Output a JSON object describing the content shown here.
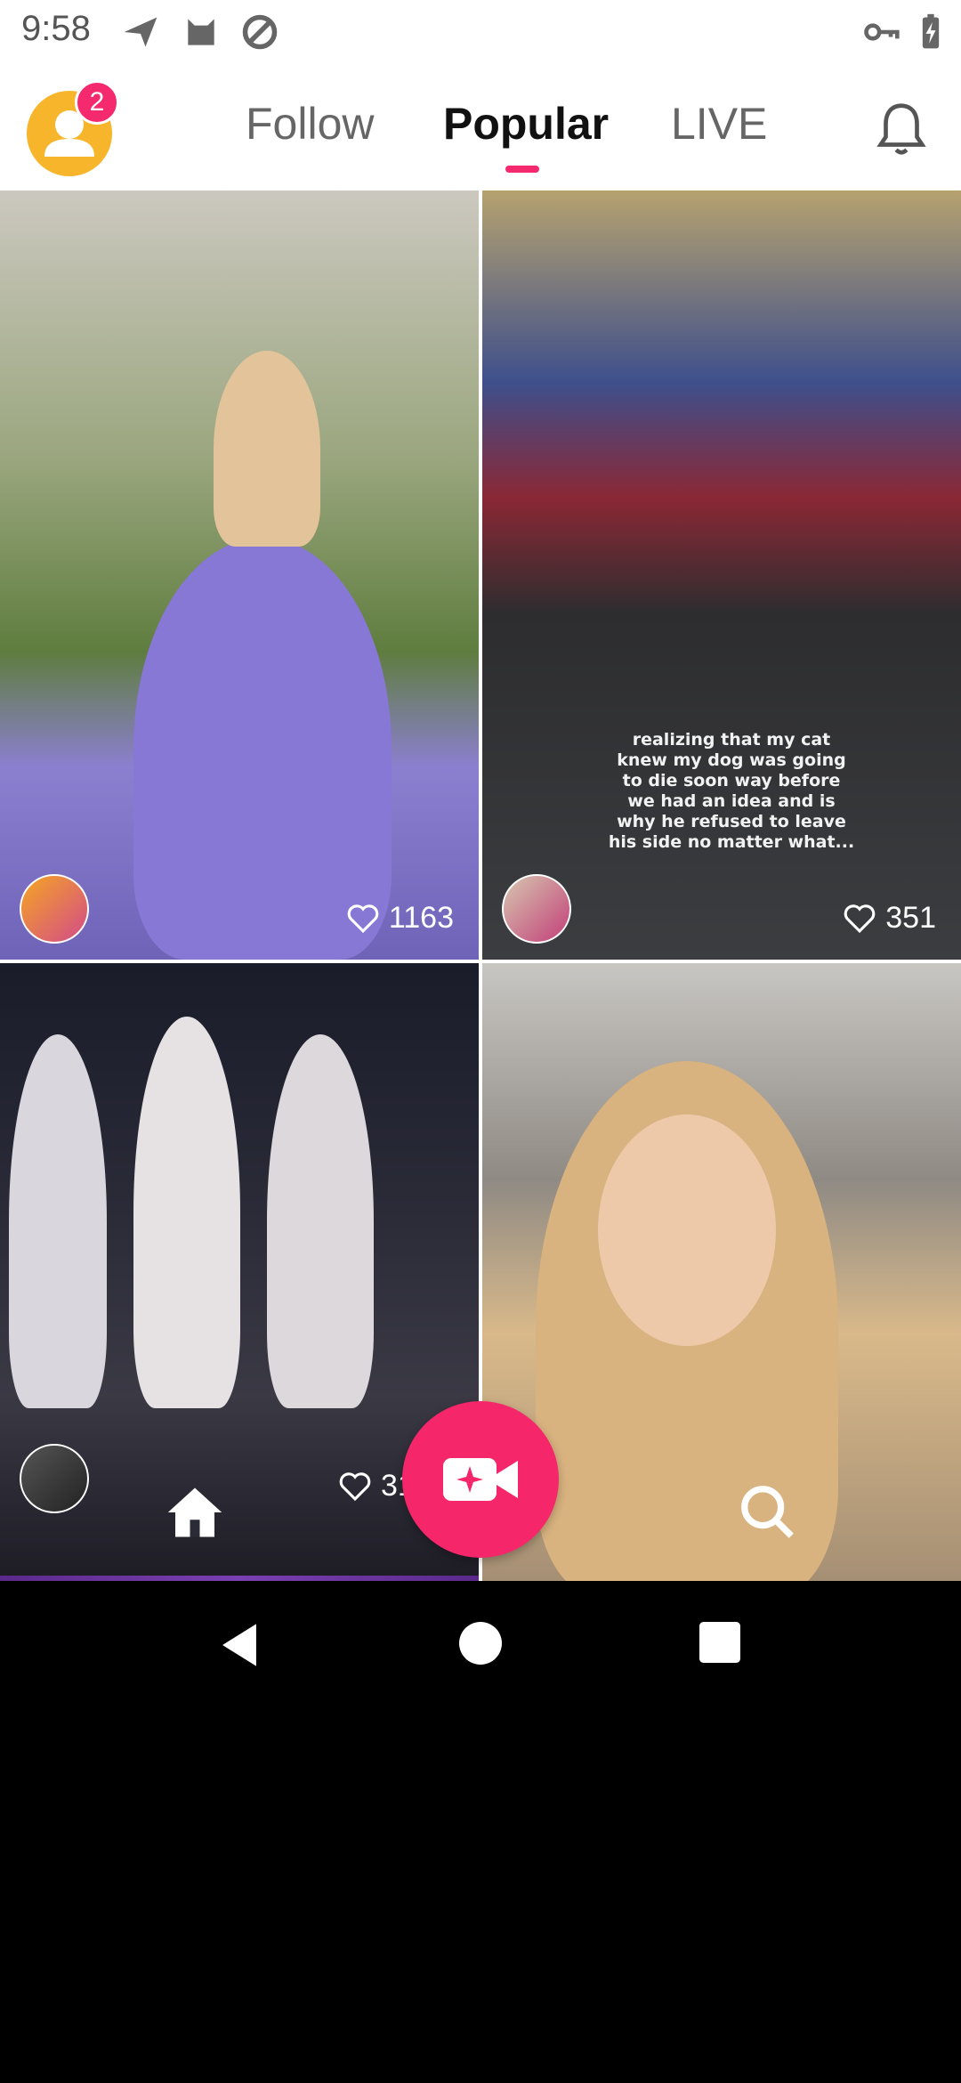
{
  "status_bar": {
    "time": "9:58",
    "icons_left": [
      "send-icon",
      "cat-icon",
      "vpn-blocked-icon"
    ],
    "icons_right": [
      "key-icon",
      "battery-charging-icon"
    ]
  },
  "header": {
    "avatar_badge": "2",
    "tabs": [
      {
        "label": "Follow",
        "active": false
      },
      {
        "label": "Popular",
        "active": true
      },
      {
        "label": "LIVE",
        "active": false
      }
    ],
    "accent_color": "#f52a6e"
  },
  "feed": {
    "cards": [
      {
        "likes": "1163",
        "caption": ""
      },
      {
        "likes": "351",
        "caption": "realizing that my cat knew my dog was going to die soon way before we had an idea and is why he refused to leave his side no matter what..."
      },
      {
        "likes": "31",
        "caption": ""
      },
      {
        "likes": "",
        "caption": ""
      }
    ]
  },
  "bottom_nav": {
    "items": [
      "home-icon",
      "record-video-icon",
      "search-icon"
    ]
  },
  "system_nav": [
    "back-icon",
    "home-circle-icon",
    "recents-icon"
  ]
}
